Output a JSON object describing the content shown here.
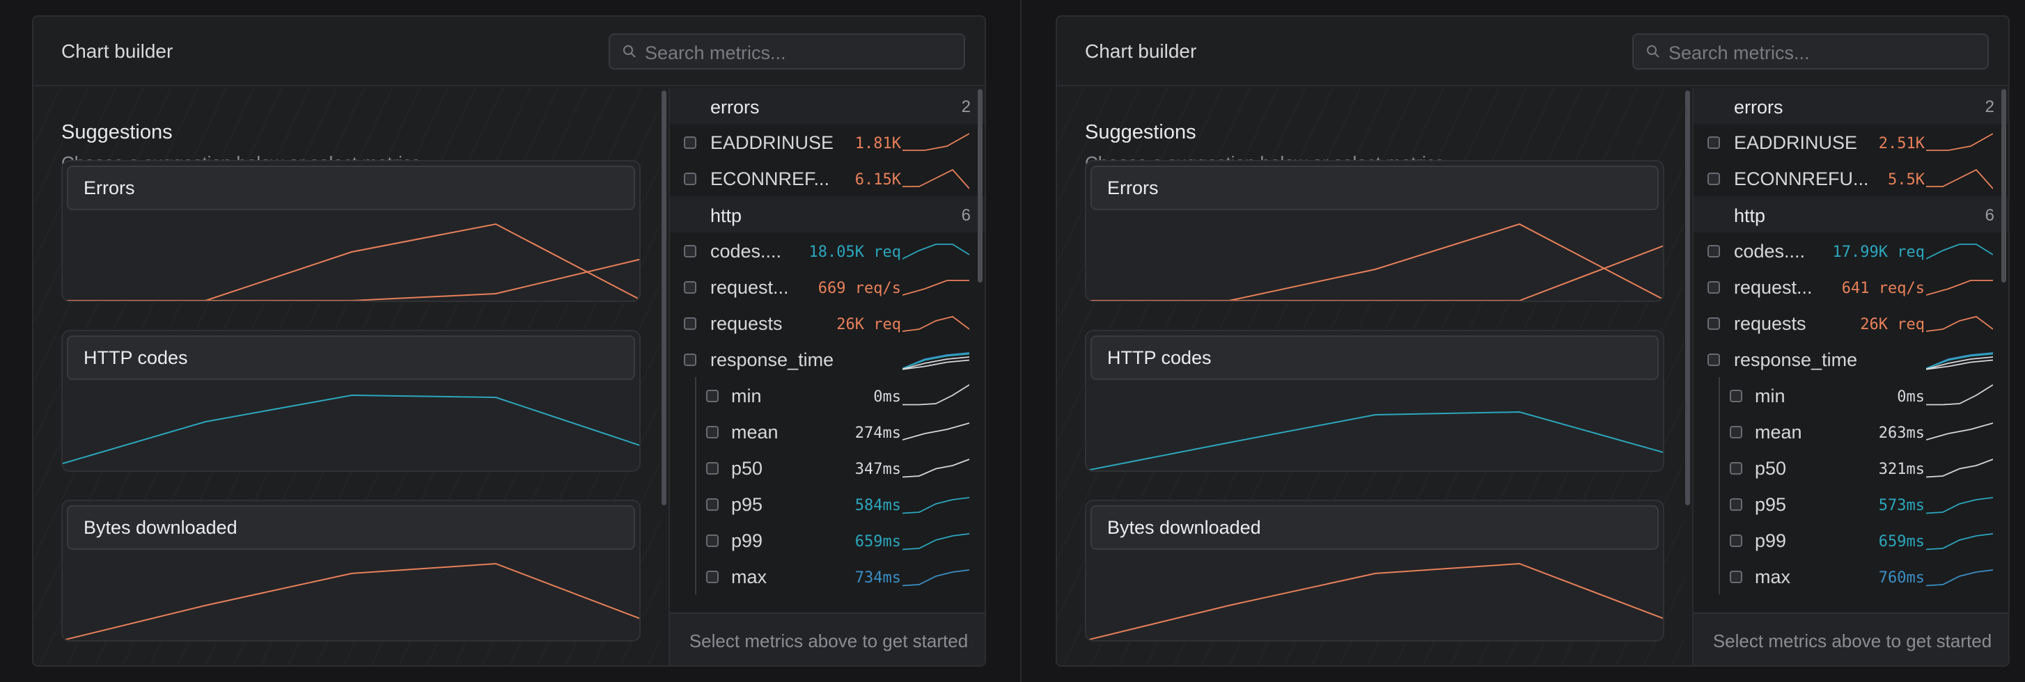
{
  "colors": {
    "orange": "#e8805a",
    "teal": "#2ba7bd",
    "blue": "#3b8fc5",
    "white": "#d8d8dc"
  },
  "panels": [
    {
      "title": "Chart builder",
      "search_placeholder": "Search metrics...",
      "suggestions": {
        "title": "Suggestions",
        "description": "Choose a suggestion below or select metrics to create your custom chart"
      },
      "cards": [
        "Errors",
        "HTTP codes",
        "Bytes downloaded"
      ],
      "groups": [
        {
          "name": "errors",
          "count": "2"
        },
        {
          "name": "http",
          "count": "6"
        }
      ],
      "metrics": [
        {
          "name": "EADDRINUSE",
          "value": "1.81K",
          "color": "orange"
        },
        {
          "name": "ECONNREF...",
          "value": "6.15K",
          "color": "orange"
        },
        {
          "name": "codes....",
          "value": "18.05K req",
          "color": "teal"
        },
        {
          "name": "request...",
          "value": "669 req/s",
          "color": "orange"
        },
        {
          "name": "requests",
          "value": "26K req",
          "color": "orange"
        },
        {
          "name": "response_time",
          "value": "",
          "color": "blue"
        },
        {
          "name": "min",
          "value": "0ms",
          "color": "white"
        },
        {
          "name": "mean",
          "value": "274ms",
          "color": "white"
        },
        {
          "name": "p50",
          "value": "347ms",
          "color": "white"
        },
        {
          "name": "p95",
          "value": "584ms",
          "color": "teal"
        },
        {
          "name": "p99",
          "value": "659ms",
          "color": "teal"
        },
        {
          "name": "max",
          "value": "734ms",
          "color": "blue"
        }
      ],
      "footer": "Select metrics above to get started"
    },
    {
      "title": "Chart builder",
      "search_placeholder": "Search metrics...",
      "suggestions": {
        "title": "Suggestions",
        "description": "Choose a suggestion below or select metrics to create your custom chart"
      },
      "cards": [
        "Errors",
        "HTTP codes",
        "Bytes downloaded"
      ],
      "groups": [
        {
          "name": "errors",
          "count": "2"
        },
        {
          "name": "http",
          "count": "6"
        }
      ],
      "metrics": [
        {
          "name": "EADDRINUSE",
          "value": "2.51K",
          "color": "orange"
        },
        {
          "name": "ECONNREFU...",
          "value": "5.5K",
          "color": "orange"
        },
        {
          "name": "codes....",
          "value": "17.99K req",
          "color": "teal"
        },
        {
          "name": "request...",
          "value": "641 req/s",
          "color": "orange"
        },
        {
          "name": "requests",
          "value": "26K req",
          "color": "orange"
        },
        {
          "name": "response_time",
          "value": "",
          "color": "blue"
        },
        {
          "name": "min",
          "value": "0ms",
          "color": "white"
        },
        {
          "name": "mean",
          "value": "263ms",
          "color": "white"
        },
        {
          "name": "p50",
          "value": "321ms",
          "color": "white"
        },
        {
          "name": "p95",
          "value": "573ms",
          "color": "teal"
        },
        {
          "name": "p99",
          "value": "659ms",
          "color": "teal"
        },
        {
          "name": "max",
          "value": "760ms",
          "color": "blue"
        }
      ],
      "footer": "Select metrics above to get started"
    }
  ]
}
